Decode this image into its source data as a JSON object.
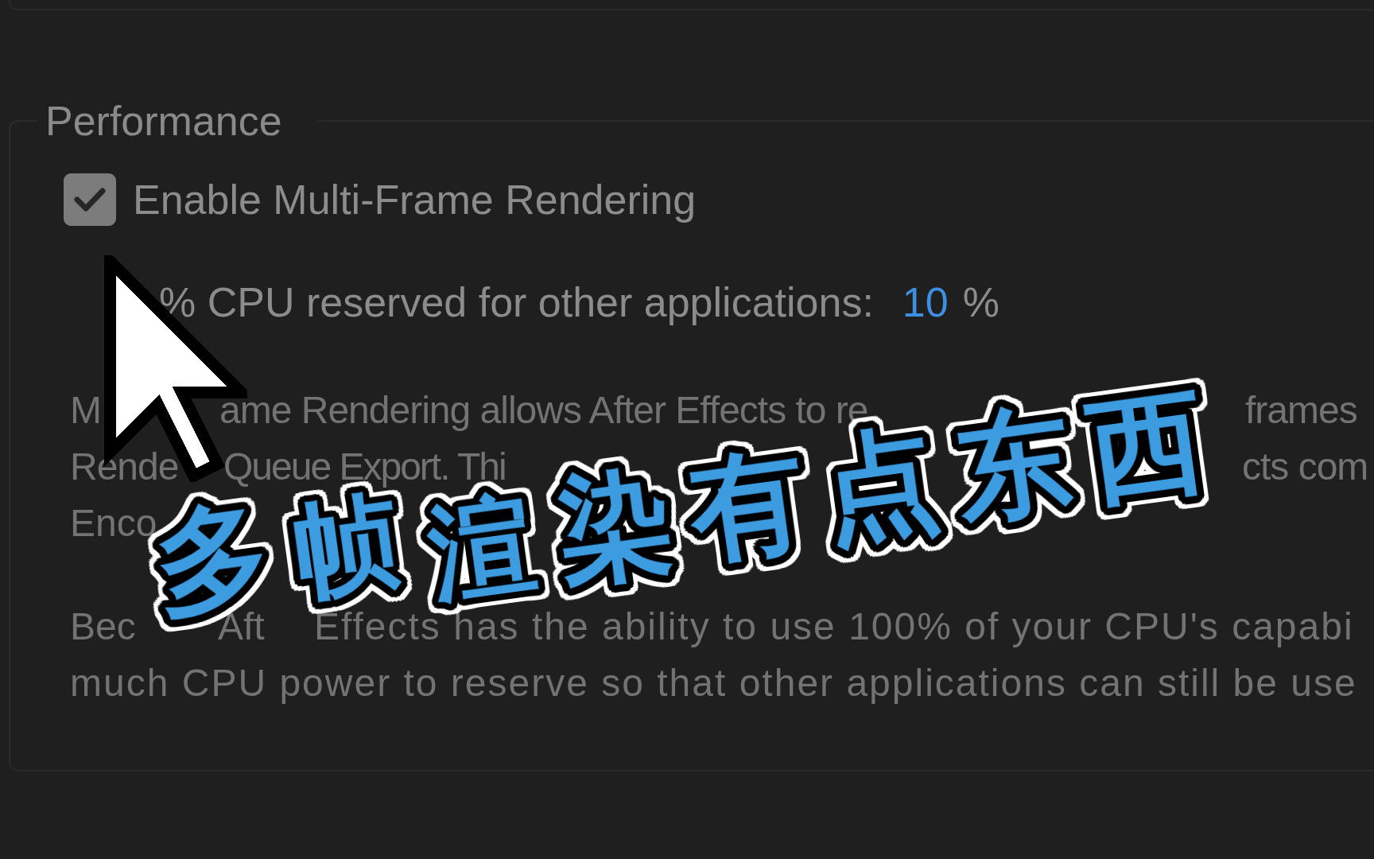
{
  "section": {
    "title": "Performance"
  },
  "multi_frame": {
    "label": "Enable Multi-Frame Rendering",
    "checked": true
  },
  "cpu_reserve": {
    "label": "% CPU reserved for other applications:",
    "value": "10",
    "unit": "%"
  },
  "description": [
    {
      "lines": [
        [
          "M",
          "ame Rendering allows After Effects to re",
          "frames"
        ],
        [
          "Rende",
          "Queue Export. Thi",
          "cts com"
        ],
        [
          "Enco"
        ]
      ]
    },
    {
      "lines": [
        [
          "Bec",
          "Aft",
          "Effects has the ability to use 100% of your CPU's capabi"
        ],
        [
          "much CPU power to reserve so that other applications can still be use"
        ]
      ]
    }
  ],
  "overlay_title": "多帧渲染有点东西"
}
